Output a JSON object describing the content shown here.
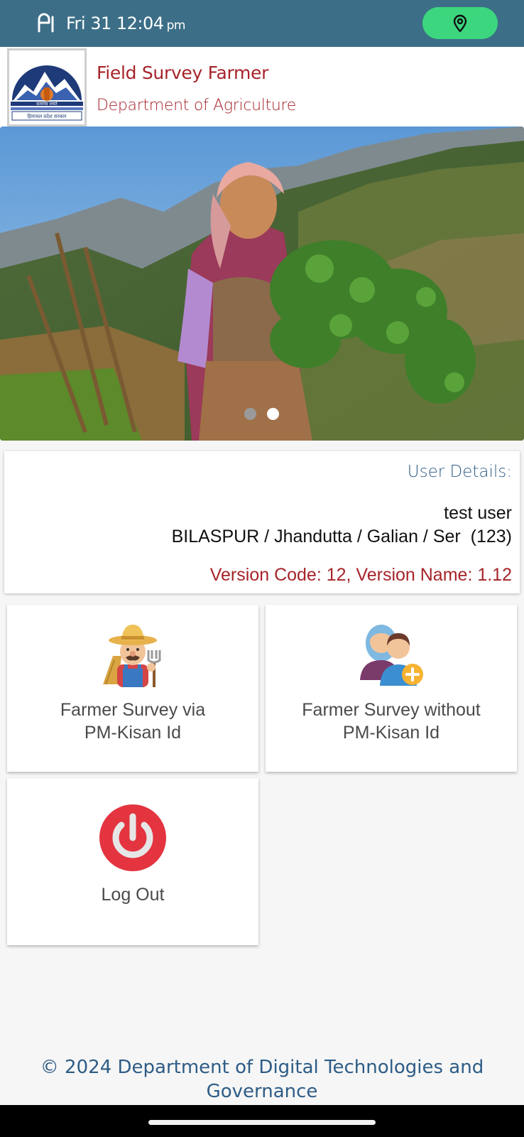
{
  "status_bar": {
    "time": "Fri 31 12:04",
    "ampm": "pm",
    "signal_icon": "cellular-signal-icon",
    "location_icon": "location-pin-icon",
    "accent_color": "#3cd67e"
  },
  "header": {
    "title": "Field Survey Farmer",
    "subtitle": "Department of Agriculture",
    "logo_icon": "himachal-pradesh-emblem-icon"
  },
  "banner": {
    "image_icon": "farmer-woman-photo",
    "active_slide": 2,
    "slide_count": 2
  },
  "user_details": {
    "label": "User Details:",
    "name": "test user",
    "location": "BILASPUR / Jhandutta / Galian / Ser  (123)",
    "version": "Version Code: 12, Version Name: 1.12"
  },
  "menu": {
    "tiles": [
      {
        "label_line1": "Farmer Survey via",
        "label_line2": "PM-Kisan Id",
        "icon": "farmer-icon"
      },
      {
        "label_line1": "Farmer Survey without",
        "label_line2": "PM-Kisan Id",
        "icon": "add-user-icon"
      },
      {
        "label": "Log Out",
        "icon": "power-icon"
      }
    ]
  },
  "footer": {
    "line1": "© 2024 Department of Digital Technologies and",
    "line2": "Governance"
  },
  "colors": {
    "status_bar": "#3c6e87",
    "brand_red": "#a6242a",
    "brand_blue": "#2e5c86"
  }
}
